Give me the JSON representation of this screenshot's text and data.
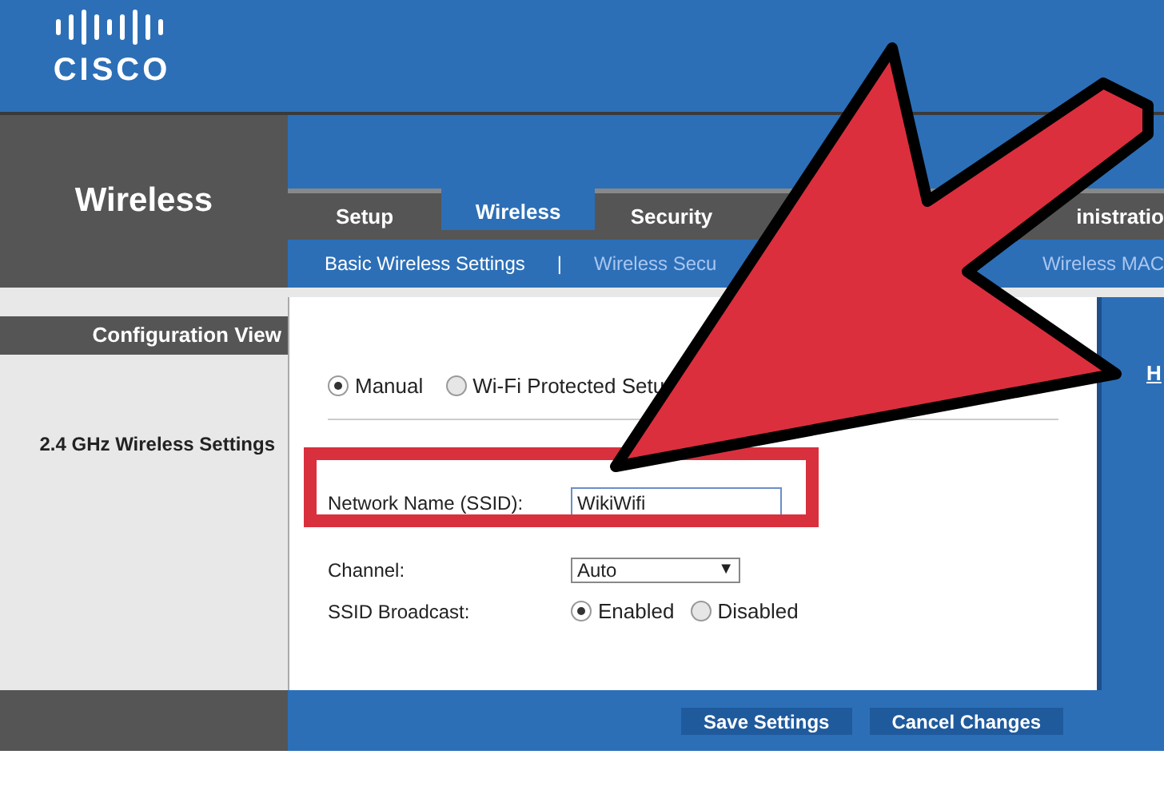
{
  "brand": {
    "logo": "CISCO"
  },
  "section": {
    "title": "Wireless"
  },
  "tabs": [
    {
      "label": "Setup",
      "selected": false
    },
    {
      "label": "Wireless",
      "selected": true
    },
    {
      "label": "Security",
      "selected": false
    },
    {
      "label": "inistratio",
      "selected": false
    }
  ],
  "subnav": [
    {
      "label": "Basic Wireless Settings",
      "selected": true
    },
    {
      "label": "|",
      "kind": "separator"
    },
    {
      "label": "Wireless Secu",
      "selected": false
    },
    {
      "label": "Wireless MAC",
      "selected": false
    }
  ],
  "sidebar": {
    "header": "Configuration View",
    "group": "2.4 GHz Wireless Settings"
  },
  "setup_mode": [
    {
      "label": "Manual",
      "selected": true
    },
    {
      "label": "Wi-Fi Protected Setu",
      "selected": false
    }
  ],
  "form": {
    "ssid_label": "Network Name (SSID):",
    "ssid_value": "WikiWifi",
    "channel_label": "Channel:",
    "channel_value": "Auto",
    "channel_caret": "▼",
    "broadcast_label": "SSID Broadcast:",
    "broadcast_options": [
      {
        "label": "Enabled",
        "selected": true
      },
      {
        "label": "Disabled",
        "selected": false
      }
    ]
  },
  "help_link": "H",
  "buttons": [
    "Save Settings",
    "Cancel Changes"
  ]
}
